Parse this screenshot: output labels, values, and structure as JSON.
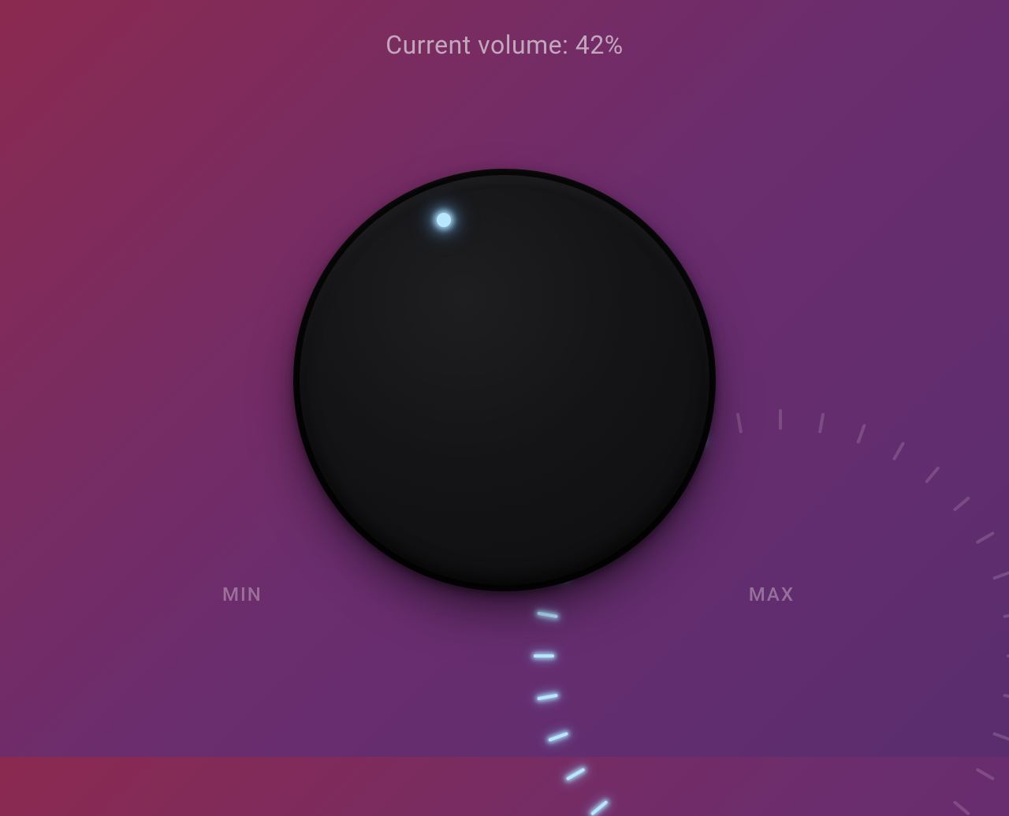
{
  "volume": {
    "label_prefix": "Current volume: ",
    "value": 42,
    "label_suffix": "%",
    "display": "Current volume: 42%"
  },
  "knob": {
    "min_label": "MIN",
    "max_label": "MAX",
    "tick_count": 27,
    "angle_start": -220,
    "angle_end": 40,
    "tick_radius": 300,
    "indicator_radius": 217,
    "colors": {
      "active_tick": "#b8e8ff",
      "inactive_tick": "rgba(200,170,200,0.25)",
      "bg_gradient_from": "#8b2a50",
      "bg_gradient_to": "#5a2d6e"
    }
  }
}
